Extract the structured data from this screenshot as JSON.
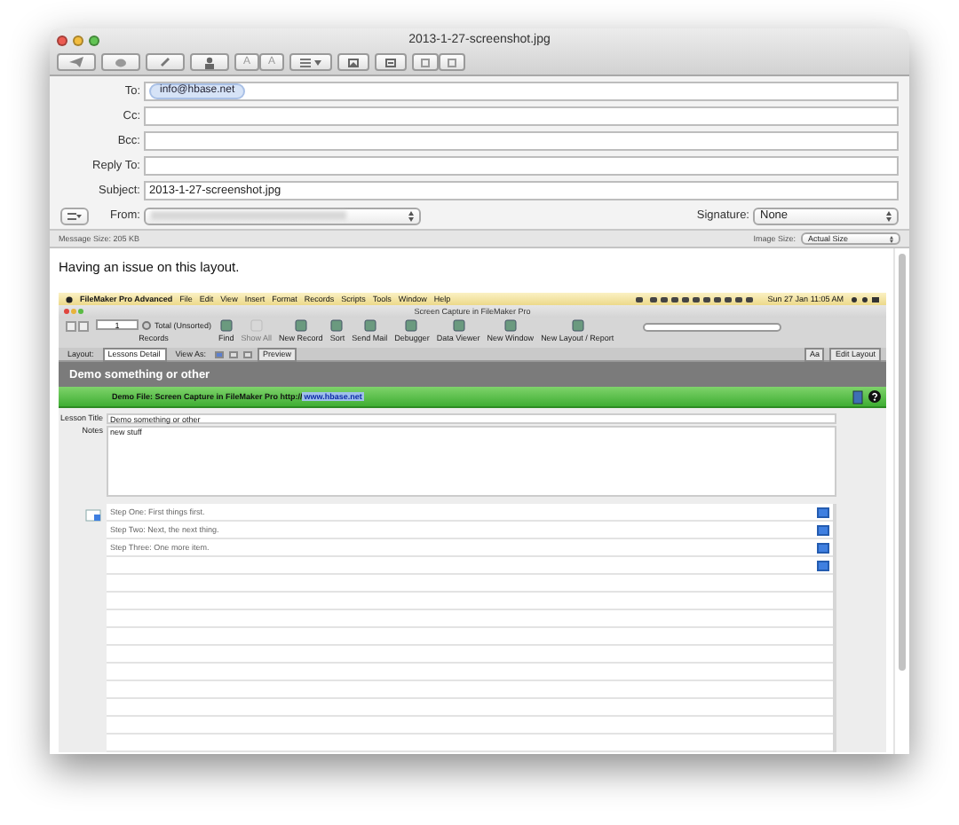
{
  "window": {
    "title": "2013-1-27-screenshot.jpg"
  },
  "toolbar": {
    "letter_buttons": [
      "A",
      "A"
    ]
  },
  "header": {
    "fields": [
      {
        "label": "To:",
        "kind": "tokens",
        "tokens": [
          "info@hbase.net"
        ]
      },
      {
        "label": "Cc:",
        "kind": "text"
      },
      {
        "label": "Bcc:",
        "kind": "text"
      },
      {
        "label": "Reply To:",
        "kind": "text"
      },
      {
        "label": "Subject:",
        "kind": "text",
        "value": "2013-1-27-screenshot.jpg"
      }
    ],
    "from": {
      "label": "From:"
    },
    "signature": {
      "label": "Signature:",
      "value": "None"
    }
  },
  "status_bar": {
    "message_size_label": "Message Size:",
    "message_size": "205 KB",
    "image_size_label": "Image Size:",
    "image_size": "Actual Size"
  },
  "body": {
    "text": "Having an issue on this layout.",
    "screenshot": {
      "menu_bar": {
        "app": "FileMaker Pro Advanced",
        "items": [
          "File",
          "Edit",
          "View",
          "Insert",
          "Format",
          "Records",
          "Scripts",
          "Tools",
          "Window",
          "Help"
        ],
        "clock": "Sun 27 Jan  11:05 AM"
      },
      "window_title": "Screen Capture in FileMaker Pro",
      "records": {
        "current": "1",
        "total": "Total (Unsorted)",
        "label": "Records"
      },
      "tools": [
        {
          "label": "Find",
          "disabled": false
        },
        {
          "label": "Show All",
          "disabled": true
        },
        {
          "label": "New Record",
          "disabled": false
        },
        {
          "label": "Sort",
          "disabled": false
        },
        {
          "label": "Send Mail",
          "disabled": false
        },
        {
          "label": "Debugger",
          "disabled": false
        },
        {
          "label": "Data Viewer",
          "disabled": false
        },
        {
          "label": "New Window",
          "disabled": false
        },
        {
          "label": "New Layout / Report",
          "disabled": false
        }
      ],
      "layout_bar": {
        "layout_label": "Layout:",
        "layout": "Lessons Detail",
        "view_label": "View As:",
        "preview": "Preview",
        "font_button": "Aa",
        "edit_layout": "Edit Layout"
      },
      "header_title": "Demo something or other",
      "banner": {
        "text": "Demo File: Screen Capture in FileMaker Pro http://",
        "link": "www.hbase.net"
      },
      "fields": [
        {
          "label": "Lesson Title",
          "value": "Demo something or other",
          "kind": "line"
        },
        {
          "label": "Notes",
          "value": "new stuff",
          "kind": "area"
        }
      ],
      "steps": [
        "Step One: First things first.",
        "Step Two: Next, the next thing.",
        "Step Three: One more item."
      ]
    }
  }
}
